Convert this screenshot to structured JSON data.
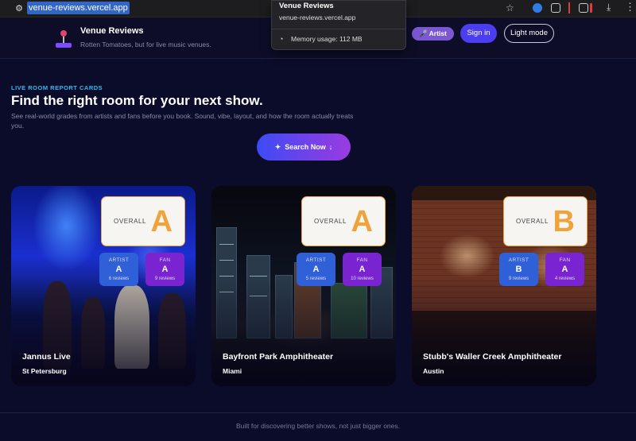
{
  "browser": {
    "url": "venue-reviews.vercel.app",
    "tooltip": {
      "title": "Venue Reviews",
      "url": "venue-reviews.vercel.app",
      "memory": "Memory usage: 112 MB"
    }
  },
  "header": {
    "brand_title": "Venue Reviews",
    "brand_subtitle": "Rotten Tomatoes, but for live music venues.",
    "artist_pill": "Artist",
    "signin_label": "Sign in",
    "lightmode_label": "Light mode"
  },
  "hero": {
    "eyebrow": "LIVE ROOM REPORT CARDS",
    "title": "Find the right room for your next show.",
    "subtitle": "See real-world grades from artists and fans before you book. Sound, vibe, layout, and how the room actually treats you.",
    "search_label": "Search Now"
  },
  "cards": [
    {
      "name": "Jannus Live",
      "city": "St Petersburg",
      "overall_label": "OVERALL",
      "overall_grade": "A",
      "artist_label": "ARTIST",
      "artist_grade": "A",
      "artist_reviews": "6 reviews",
      "fan_label": "FAN",
      "fan_grade": "A",
      "fan_reviews": "9 reviews"
    },
    {
      "name": "Bayfront Park Amphitheater",
      "city": "Miami",
      "overall_label": "OVERALL",
      "overall_grade": "A",
      "artist_label": "ARTIST",
      "artist_grade": "A",
      "artist_reviews": "5 reviews",
      "fan_label": "FAN",
      "fan_grade": "A",
      "fan_reviews": "10 reviews"
    },
    {
      "name": "Stubb's Waller Creek Amphitheater",
      "city": "Austin",
      "overall_label": "OVERALL",
      "overall_grade": "B",
      "artist_label": "ARTIST",
      "artist_grade": "B",
      "artist_reviews": "9 reviews",
      "fan_label": "FAN",
      "fan_grade": "A",
      "fan_reviews": "4 reviews"
    }
  ],
  "footer": {
    "text": "Built for discovering better shows, not just bigger ones."
  },
  "colors": {
    "background": "#0b0b2a",
    "accent_blue": "#4b3ef0",
    "grade_orange": "#f0a33a",
    "artist_blue": "#2f60d8",
    "fan_purple": "#7a24d1",
    "eyebrow_cyan": "#35b8f0"
  }
}
